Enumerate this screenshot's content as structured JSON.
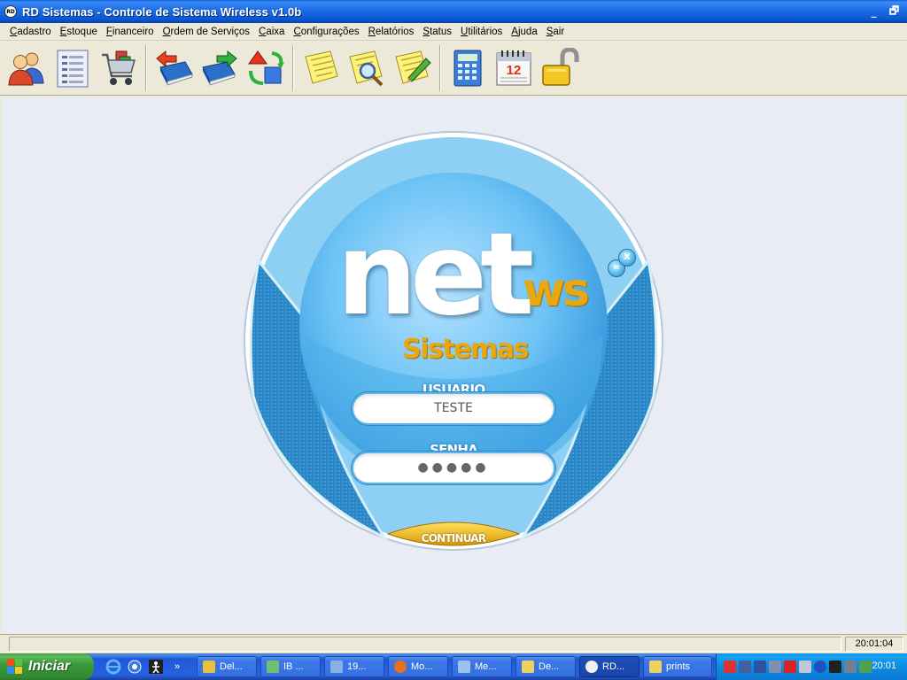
{
  "window": {
    "title": "RD Sistemas - Controle de Sistema Wireless v1.0b",
    "app_icon_text": "RD",
    "minimize_glyph": "_",
    "restore_glyph": "🗗"
  },
  "menu": [
    "Cadastro",
    "Estoque",
    "Financeiro",
    "Ordem de Serviços",
    "Caixa",
    "Configurações",
    "Relatórios",
    "Status",
    "Utilitários",
    "Ajuda",
    "Sair"
  ],
  "toolbar": {
    "icons": [
      "users-icon",
      "document-list-icon",
      "shopping-cart-icon",
      "book-back-icon",
      "book-forward-icon",
      "recycle-icon",
      "notepad-icon",
      "notepad-search-icon",
      "notepad-edit-icon",
      "calculator-icon",
      "calendar-icon",
      "padlock-icon"
    ],
    "calendar_day": "12"
  },
  "login": {
    "logo_main": "net",
    "logo_suffix": "ws",
    "logo_sub": "Sistemas",
    "user_label": "USUARIO",
    "user_value": "TESTE",
    "password_label": "SENHA",
    "password_mask": "●●●●●",
    "submit_label": "CONTINUAR",
    "minimize_glyph": "=",
    "close_glyph": "X",
    "colors": {
      "accent_orange": "#e8a810",
      "sphere_blue": "#5cbaf0"
    }
  },
  "status": {
    "clock": "20:01:04"
  },
  "taskbar": {
    "start_label": "Iniciar",
    "quick_more": "»",
    "tasks": [
      {
        "label": "Del...",
        "icon_color": "#e8c040",
        "active": false
      },
      {
        "label": "IB ...",
        "icon_color": "#70c070",
        "active": false
      },
      {
        "label": "19...",
        "icon_color": "#8ab0e8",
        "active": false
      },
      {
        "label": "Mo...",
        "icon_color": "#e87020",
        "active": false
      },
      {
        "label": "Me...",
        "icon_color": "#a0c0f0",
        "active": false
      },
      {
        "label": "De...",
        "icon_color": "#f0d060",
        "active": false
      },
      {
        "label": "RD...",
        "icon_color": "#f0f0f0",
        "active": true
      },
      {
        "label": "prints",
        "icon_color": "#f0d060",
        "active": false
      }
    ],
    "tray_time": "20:01"
  }
}
